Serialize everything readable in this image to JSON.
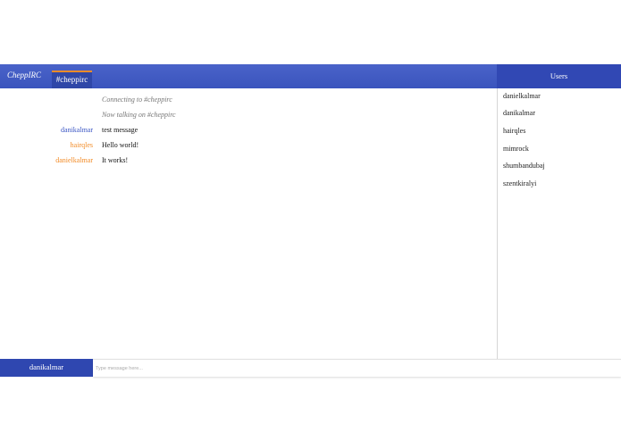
{
  "app": {
    "brand": "CheppIRC"
  },
  "header": {
    "active_channel": "#cheppirc"
  },
  "messages": [
    {
      "nick": "",
      "text": "Connecting to #cheppirc",
      "type": "system",
      "nick_color": ""
    },
    {
      "nick": "",
      "text": "Now talking on #cheppirc",
      "type": "system",
      "nick_color": ""
    },
    {
      "nick": "danikalmar",
      "text": "test message",
      "type": "message",
      "nick_color": "#3b56c4"
    },
    {
      "nick": "hairqles",
      "text": "Hello world!",
      "type": "message",
      "nick_color": "#f28c28"
    },
    {
      "nick": "danielkalmar",
      "text": "It works!",
      "type": "message",
      "nick_color": "#f28c28"
    }
  ],
  "users_panel": {
    "title": "Users",
    "users": [
      "danielkalmar",
      "danikalmar",
      "hairqles",
      "mimrock",
      "shumbandubaj",
      "szentkiralyi"
    ]
  },
  "footer": {
    "current_nick": "danikalmar",
    "input_placeholder": "Type message here...",
    "input_value": ""
  },
  "colors": {
    "header_bg": "#3a54bd",
    "users_header_bg": "#3148b4",
    "tab_accent": "#f28c28",
    "footer_nick_bg": "#2f47b0"
  }
}
